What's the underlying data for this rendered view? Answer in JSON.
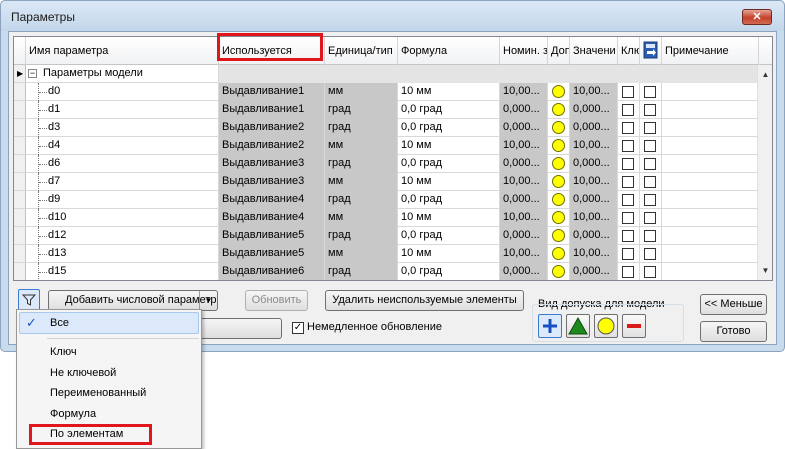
{
  "window": {
    "title": "Параметры",
    "close_label": "✕"
  },
  "columns": {
    "name": "Имя параметра",
    "used": "Используется",
    "unit": "Единица/тип",
    "formula": "Формула",
    "nominal": "Номин. з",
    "tol": "Доп",
    "value": "Значени",
    "key": "Клю",
    "note": "Примечание"
  },
  "group_row": {
    "label": "Параметры модели",
    "expander": "−"
  },
  "rows": [
    {
      "name": "d0",
      "used": "Выдавливание1",
      "unit": "мм",
      "formula": "10 мм",
      "nominal": "10,00...",
      "value": "10,00..."
    },
    {
      "name": "d1",
      "used": "Выдавливание1",
      "unit": "град",
      "formula": "0,0 град",
      "nominal": "0,000...",
      "value": "0,000..."
    },
    {
      "name": "d3",
      "used": "Выдавливание2",
      "unit": "град",
      "formula": "0,0 град",
      "nominal": "0,000...",
      "value": "0,000..."
    },
    {
      "name": "d4",
      "used": "Выдавливание2",
      "unit": "мм",
      "formula": "10 мм",
      "nominal": "10,00...",
      "value": "10,00..."
    },
    {
      "name": "d6",
      "used": "Выдавливание3",
      "unit": "град",
      "formula": "0,0 град",
      "nominal": "0,000...",
      "value": "0,000..."
    },
    {
      "name": "d7",
      "used": "Выдавливание3",
      "unit": "мм",
      "formula": "10 мм",
      "nominal": "10,00...",
      "value": "10,00..."
    },
    {
      "name": "d9",
      "used": "Выдавливание4",
      "unit": "град",
      "formula": "0,0 град",
      "nominal": "0,000...",
      "value": "0,000..."
    },
    {
      "name": "d10",
      "used": "Выдавливание4",
      "unit": "мм",
      "formula": "10 мм",
      "nominal": "10,00...",
      "value": "10,00..."
    },
    {
      "name": "d12",
      "used": "Выдавливание5",
      "unit": "град",
      "formula": "0,0 град",
      "nominal": "0,000...",
      "value": "0,000..."
    },
    {
      "name": "d13",
      "used": "Выдавливание5",
      "unit": "мм",
      "formula": "10 мм",
      "nominal": "10,00...",
      "value": "10,00..."
    },
    {
      "name": "d15",
      "used": "Выдавливание6",
      "unit": "град",
      "formula": "0,0 град",
      "nominal": "0,000...",
      "value": "0,000..."
    }
  ],
  "toolbar": {
    "add_param": "Добавить числовой параметр",
    "update": "Обновить",
    "delete_unused": "Удалить неиспользуемые элементы",
    "less": "<< Меньше",
    "done": "Готово",
    "immediate_update": "Немедленное обновление",
    "tolerance_group": "Вид допуска для модели"
  },
  "filter_menu": {
    "items": [
      "Все",
      "Ключ",
      "Не ключевой",
      "Переименованный",
      "Формула",
      "По элементам"
    ],
    "checked_index": 0
  },
  "colors": {
    "highlight": "#e0161d",
    "used_column_bg": "#c8c8c8",
    "tolerance_circle": "#ffff00"
  }
}
